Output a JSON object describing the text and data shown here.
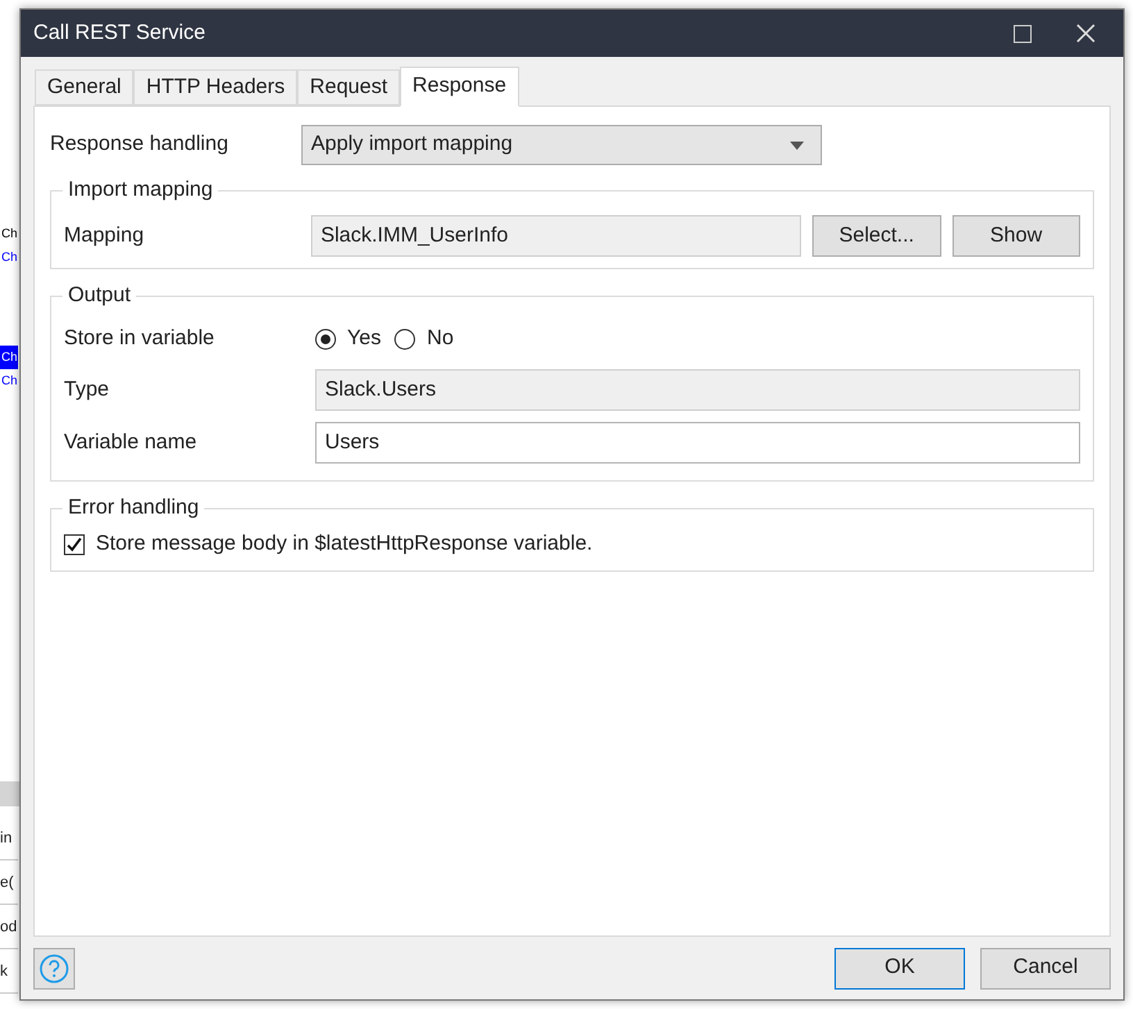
{
  "background": {
    "upper_items": [
      {
        "label": "Ch",
        "selected": false,
        "color": "#000000"
      },
      {
        "label": "Ch",
        "selected": false,
        "color": "#0000ff"
      },
      {
        "label": "Ch",
        "selected": true
      },
      {
        "label": "Ch",
        "selected": false,
        "color": "#0000ff"
      }
    ],
    "lower_items": [
      "in",
      "e(",
      "od",
      "k"
    ]
  },
  "window": {
    "title": "Call REST Service"
  },
  "tabs": [
    {
      "label": "General",
      "selected": false
    },
    {
      "label": "HTTP Headers",
      "selected": false
    },
    {
      "label": "Request",
      "selected": false
    },
    {
      "label": "Response",
      "selected": true
    }
  ],
  "response_handling": {
    "label": "Response handling",
    "value": "Apply import mapping"
  },
  "import_mapping": {
    "title": "Import mapping",
    "label": "Mapping",
    "value": "Slack.IMM_UserInfo",
    "buttons": [
      "Select...",
      "Show"
    ]
  },
  "output": {
    "title": "Output",
    "store_label": "Store in variable",
    "options": [
      {
        "label": "Yes",
        "selected": true
      },
      {
        "label": "No",
        "selected": false
      }
    ],
    "type_label": "Type",
    "type_value": "Slack.Users",
    "name_label": "Variable name",
    "name_value": "Users"
  },
  "error_handling": {
    "title": "Error handling",
    "checkbox": {
      "label": "Store message body in $latestHttpResponse variable.",
      "checked": true
    }
  },
  "buttons": [
    {
      "label": "OK",
      "default": true
    },
    {
      "label": "Cancel",
      "default": false
    }
  ]
}
